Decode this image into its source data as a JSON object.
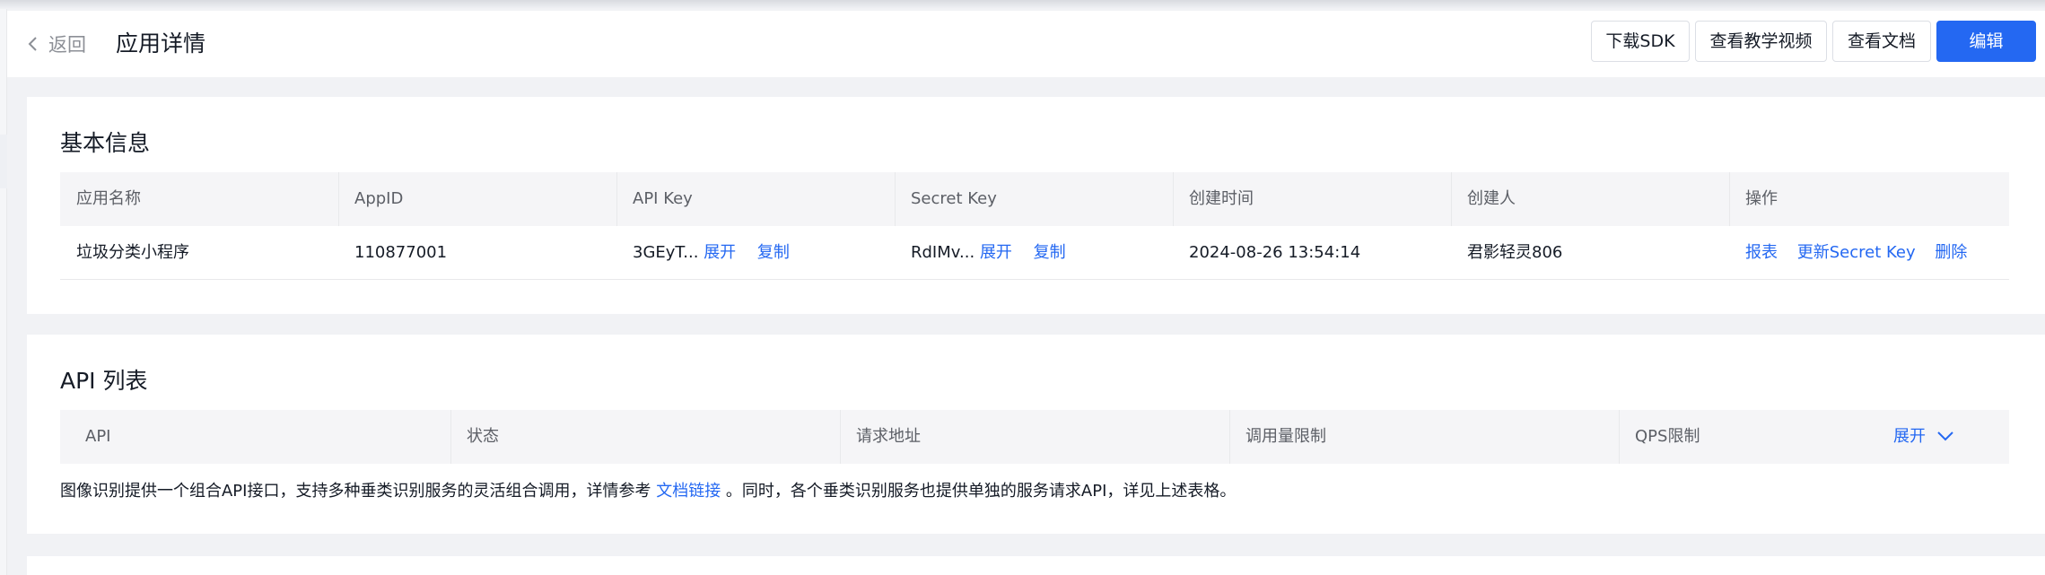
{
  "header": {
    "back_label": "返回",
    "title": "应用详情",
    "buttons": {
      "download_sdk": "下载SDK",
      "tutorial_video": "查看教学视频",
      "docs": "查看文档",
      "edit": "编辑"
    }
  },
  "basic_info": {
    "title": "基本信息",
    "columns": [
      "应用名称",
      "AppID",
      "API Key",
      "Secret Key",
      "创建时间",
      "创建人",
      "操作"
    ],
    "row": {
      "app_name": "垃圾分类小程序",
      "app_id": "110877001",
      "api_key_masked": "3GEyT...",
      "secret_key_masked": "RdIMv...",
      "expand_label": "展开",
      "copy_label": "复制",
      "created_at": "2024-08-26 13:54:14",
      "creator": "君影轻灵806",
      "actions": {
        "report": "报表",
        "update_secret": "更新Secret Key",
        "delete": "删除"
      }
    }
  },
  "api_list": {
    "title": "API 列表",
    "columns": [
      "API",
      "状态",
      "请求地址",
      "调用量限制",
      "QPS限制"
    ],
    "expand_label": "展开",
    "note_before": "图像识别提供一个组合API接口，支持多种垂类识别服务的灵活组合调用，详情参考 ",
    "note_link": "文档链接",
    "note_after": " 。同时，各个垂类识别服务也提供单独的服务请求API，详见上述表格。"
  },
  "colors": {
    "primary": "#2468f2",
    "text": "#151b26",
    "muted": "#5c5f66",
    "page_bg": "#f1f2f5"
  },
  "icons": {
    "back": "chevron-left-icon",
    "expand": "chevron-down-icon"
  }
}
